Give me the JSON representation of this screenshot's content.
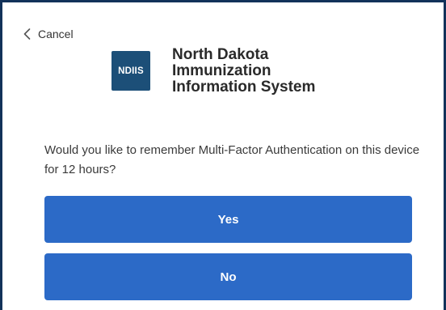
{
  "header": {
    "cancel_label": "Cancel",
    "back_icon": "chevron-left-icon"
  },
  "brand": {
    "logo_text": "NDIIS",
    "title_lines": [
      "North Dakota",
      "Immunization",
      "Information System"
    ]
  },
  "prompt": {
    "question": "Would you like to remember Multi-Factor Authentication on this device for 12 hours?"
  },
  "actions": {
    "yes_label": "Yes",
    "no_label": "No"
  },
  "colors": {
    "frame_border": "#12325a",
    "logo_background": "#1c4f78",
    "button_background": "#2c6ac7",
    "button_text": "#ffffff"
  }
}
